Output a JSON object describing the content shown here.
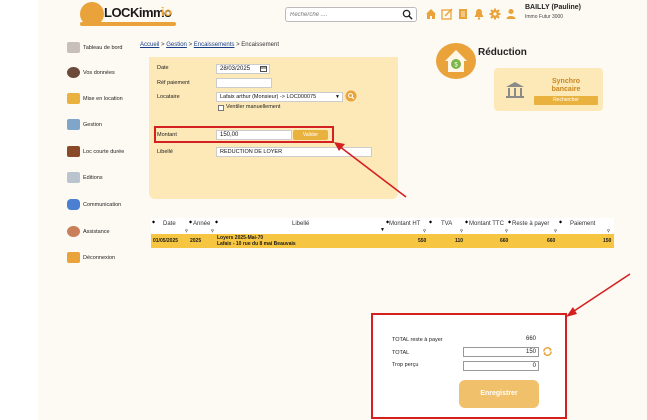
{
  "header": {
    "logo_text": "LOCKimmo",
    "logo_suffix": "io",
    "search_placeholder": "Recherche ....",
    "user_name": "BAILLY (Pauline)",
    "user_org": "Immo Futur 3000",
    "icons": [
      "home-icon",
      "edit-icon",
      "document-icon",
      "bell-icon",
      "gear-icon",
      "user-icon"
    ]
  },
  "sidebar": {
    "items": [
      {
        "label": "Tableau de bord",
        "icon": "dashboard-icon"
      },
      {
        "label": "Vos données",
        "icon": "user-data-icon"
      },
      {
        "label": "Mise en location",
        "icon": "keys-icon"
      },
      {
        "label": "Gestion",
        "icon": "management-icon"
      },
      {
        "label": "Loc courte durée",
        "icon": "suitcase-icon"
      },
      {
        "label": "Editions",
        "icon": "print-icon"
      },
      {
        "label": "Communication",
        "icon": "chat-icon"
      },
      {
        "label": "Assistance",
        "icon": "support-icon"
      },
      {
        "label": "Déconnexion",
        "icon": "logout-icon"
      }
    ]
  },
  "breadcrumb": {
    "items": [
      "Accueil",
      "Gestion",
      "Encaissements",
      "Encaissement"
    ],
    "separator": ">"
  },
  "form": {
    "date_label": "Date",
    "date_value": "28/03/2025",
    "ref_label": "Réf paiement",
    "ref_value": "",
    "locataire_label": "Locataire",
    "locataire_value": "Lafaix arthur (Monsieur) -> LOC000075",
    "ventiler_label": "Ventiler manuellement",
    "montant_label": "Montant",
    "montant_value": "150,00",
    "valider_label": "Valider",
    "libelle_label": "Libellé",
    "libelle_value": "REDUCTION DE LOYER"
  },
  "reduction": {
    "title": "Réduction",
    "icon": "piggy-bank-house-icon"
  },
  "synchro": {
    "title_line1": "Synchro",
    "title_line2": "bancaire",
    "button": "Rechercher",
    "icon": "bank-icon"
  },
  "table": {
    "columns": [
      "Date",
      "Année",
      "Libellé",
      "Montant HT",
      "TVA",
      "Montant TTC",
      "Reste à payer",
      "Paiement"
    ],
    "rows": [
      {
        "date": "01/05/2025",
        "annee": "2025",
        "libelle_line1": "Loyers 2025-Mai-70",
        "libelle_line2": "Lafaix - 10 rue du 8 mai Beauvais",
        "montant_ht": "550",
        "tva": "110",
        "montant_ttc": "660",
        "reste": "660",
        "paiement": "150"
      }
    ]
  },
  "totals": {
    "reste_label": "TOTAL reste à payer",
    "reste_value": "660",
    "total_label": "TOTAL",
    "total_value": "150",
    "trop_label": "Trop perçu",
    "trop_value": "0",
    "save_label": "Enregistrer"
  },
  "colors": {
    "accent": "#e9a33a",
    "panel": "#fde9b7",
    "row_highlight": "#f6c542",
    "annotation_red": "#d42020"
  }
}
